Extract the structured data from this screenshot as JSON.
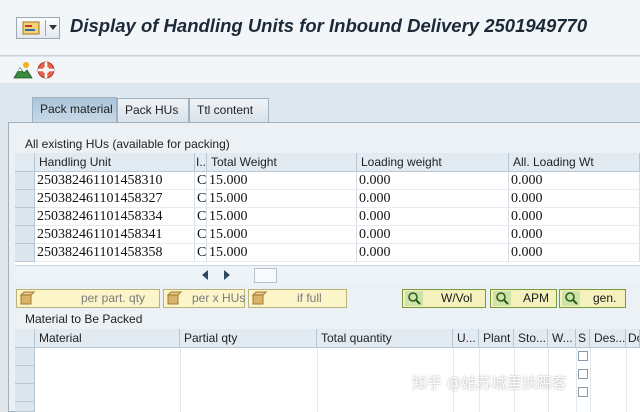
{
  "window": {
    "title": "Display of Handling Units for Inbound Delivery 2501949770"
  },
  "toolbar": {
    "icons": [
      "mountain-icon",
      "lifebuoy-icon"
    ]
  },
  "tabs": [
    {
      "label": "Pack material",
      "active": true
    },
    {
      "label": "Pack HUs",
      "active": false
    },
    {
      "label": "Ttl content",
      "active": false
    }
  ],
  "hu_section": {
    "title": "All existing HUs (available for packing)",
    "columns": [
      "Handling Unit",
      "I..",
      "Total Weight",
      "Loading weight",
      "All. Loading Wt"
    ],
    "rows": [
      {
        "hu": "250382461101458310",
        "i": "C",
        "total": "15.000",
        "loading": "0.000",
        "allowed": "0.000"
      },
      {
        "hu": "250382461101458327",
        "i": "C",
        "total": "15.000",
        "loading": "0.000",
        "allowed": "0.000"
      },
      {
        "hu": "250382461101458334",
        "i": "C",
        "total": "15.000",
        "loading": "0.000",
        "allowed": "0.000"
      },
      {
        "hu": "250382461101458341",
        "i": "C",
        "total": "15.000",
        "loading": "0.000",
        "allowed": "0.000"
      },
      {
        "hu": "250382461101458358",
        "i": "C",
        "total": "15.000",
        "loading": "0.000",
        "allowed": "0.000"
      }
    ]
  },
  "pack_buttons": {
    "per_part_qty": "per part. qty",
    "per_x_hus": "per x HUs",
    "if_full": "if full",
    "wvol": "W/Vol",
    "apm": "APM",
    "gen": "gen."
  },
  "material_section": {
    "title": "Material to Be Packed",
    "columns": [
      "Material",
      "Partial qty",
      "Total quantity",
      "U...",
      "Plant",
      "Sto...",
      "W...",
      "S",
      "Des...",
      "Do"
    ]
  },
  "watermark": "知乎 @姑苏城里扶踢客",
  "colors": {
    "title_text": "#1c2a38",
    "active_tab": "#a9c4da",
    "pack_button": "#fbf5c9"
  }
}
